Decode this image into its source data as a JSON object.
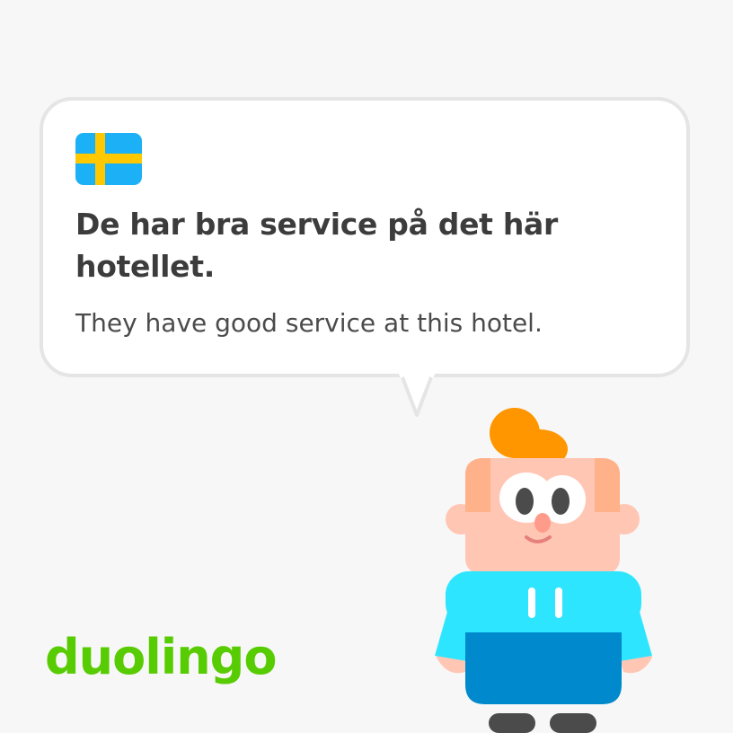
{
  "sentence": "De har bra service på det här hotellet.",
  "translation": "They have good service at this hotel.",
  "brand": "duolingo",
  "flag_icon": "sweden-flag-icon",
  "colors": {
    "background": "#f7f7f7",
    "bubble_border": "#e5e5e5",
    "brand_green": "#58cc02",
    "flag_blue": "#1cb0f6",
    "flag_yellow": "#ffc800",
    "hair": "#ff9600",
    "skin": "#ffc6b4",
    "shirt": "#2ee5ff",
    "apron": "#0089cc"
  }
}
